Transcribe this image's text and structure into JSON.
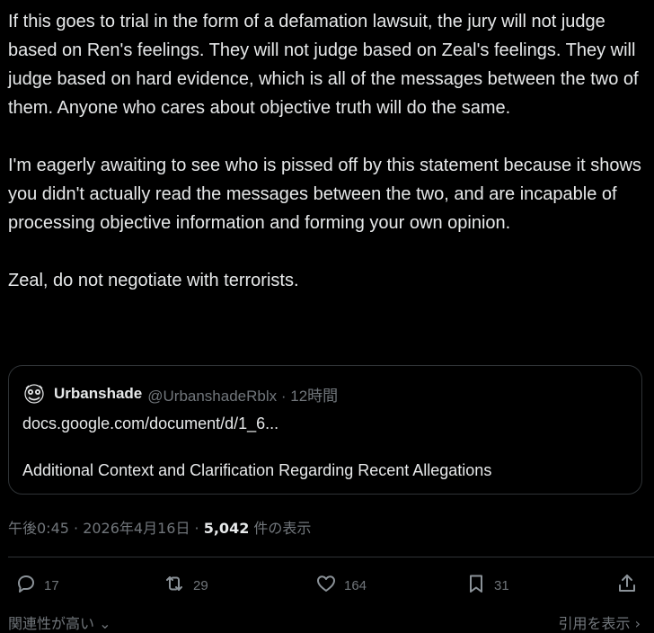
{
  "post": {
    "paragraphs": [
      "If this goes to trial in the form of a defamation lawsuit, the jury will not judge based on Ren's feelings. They will not judge based on Zeal's feelings. They will judge based on hard evidence, which is all of the messages between the two of them. Anyone who cares about objective truth will do the same.",
      "I'm eagerly awaiting to see who is pissed off by this statement because it shows you didn't actually read the messages between the two, and are incapable of processing objective information and forming your own opinion.",
      "Zeal, do not negotiate with terrorists."
    ]
  },
  "quote": {
    "avatar_icon": "avatar-icon",
    "display_name": "Urbanshade",
    "handle_and_time": "@UrbanshadeRblx · 12時間",
    "link_text": "docs.google.com/document/d/1_6...",
    "card_title": "Additional Context and Clarification Regarding Recent Allegations"
  },
  "meta": {
    "time_date": "午後0:45 · 2026年4月16日 · ",
    "views_count": "5,042",
    "views_label": " 件の表示"
  },
  "actions": {
    "replies": "17",
    "reposts": "29",
    "likes": "164",
    "bookmarks": "31"
  },
  "footer": {
    "relevance_label": "関連性が高い",
    "quotes_label": "引用を表示"
  },
  "colors": {
    "background": "#000000",
    "text_primary": "#e7e9ea",
    "text_secondary": "#71767b",
    "border": "#2f3336"
  }
}
